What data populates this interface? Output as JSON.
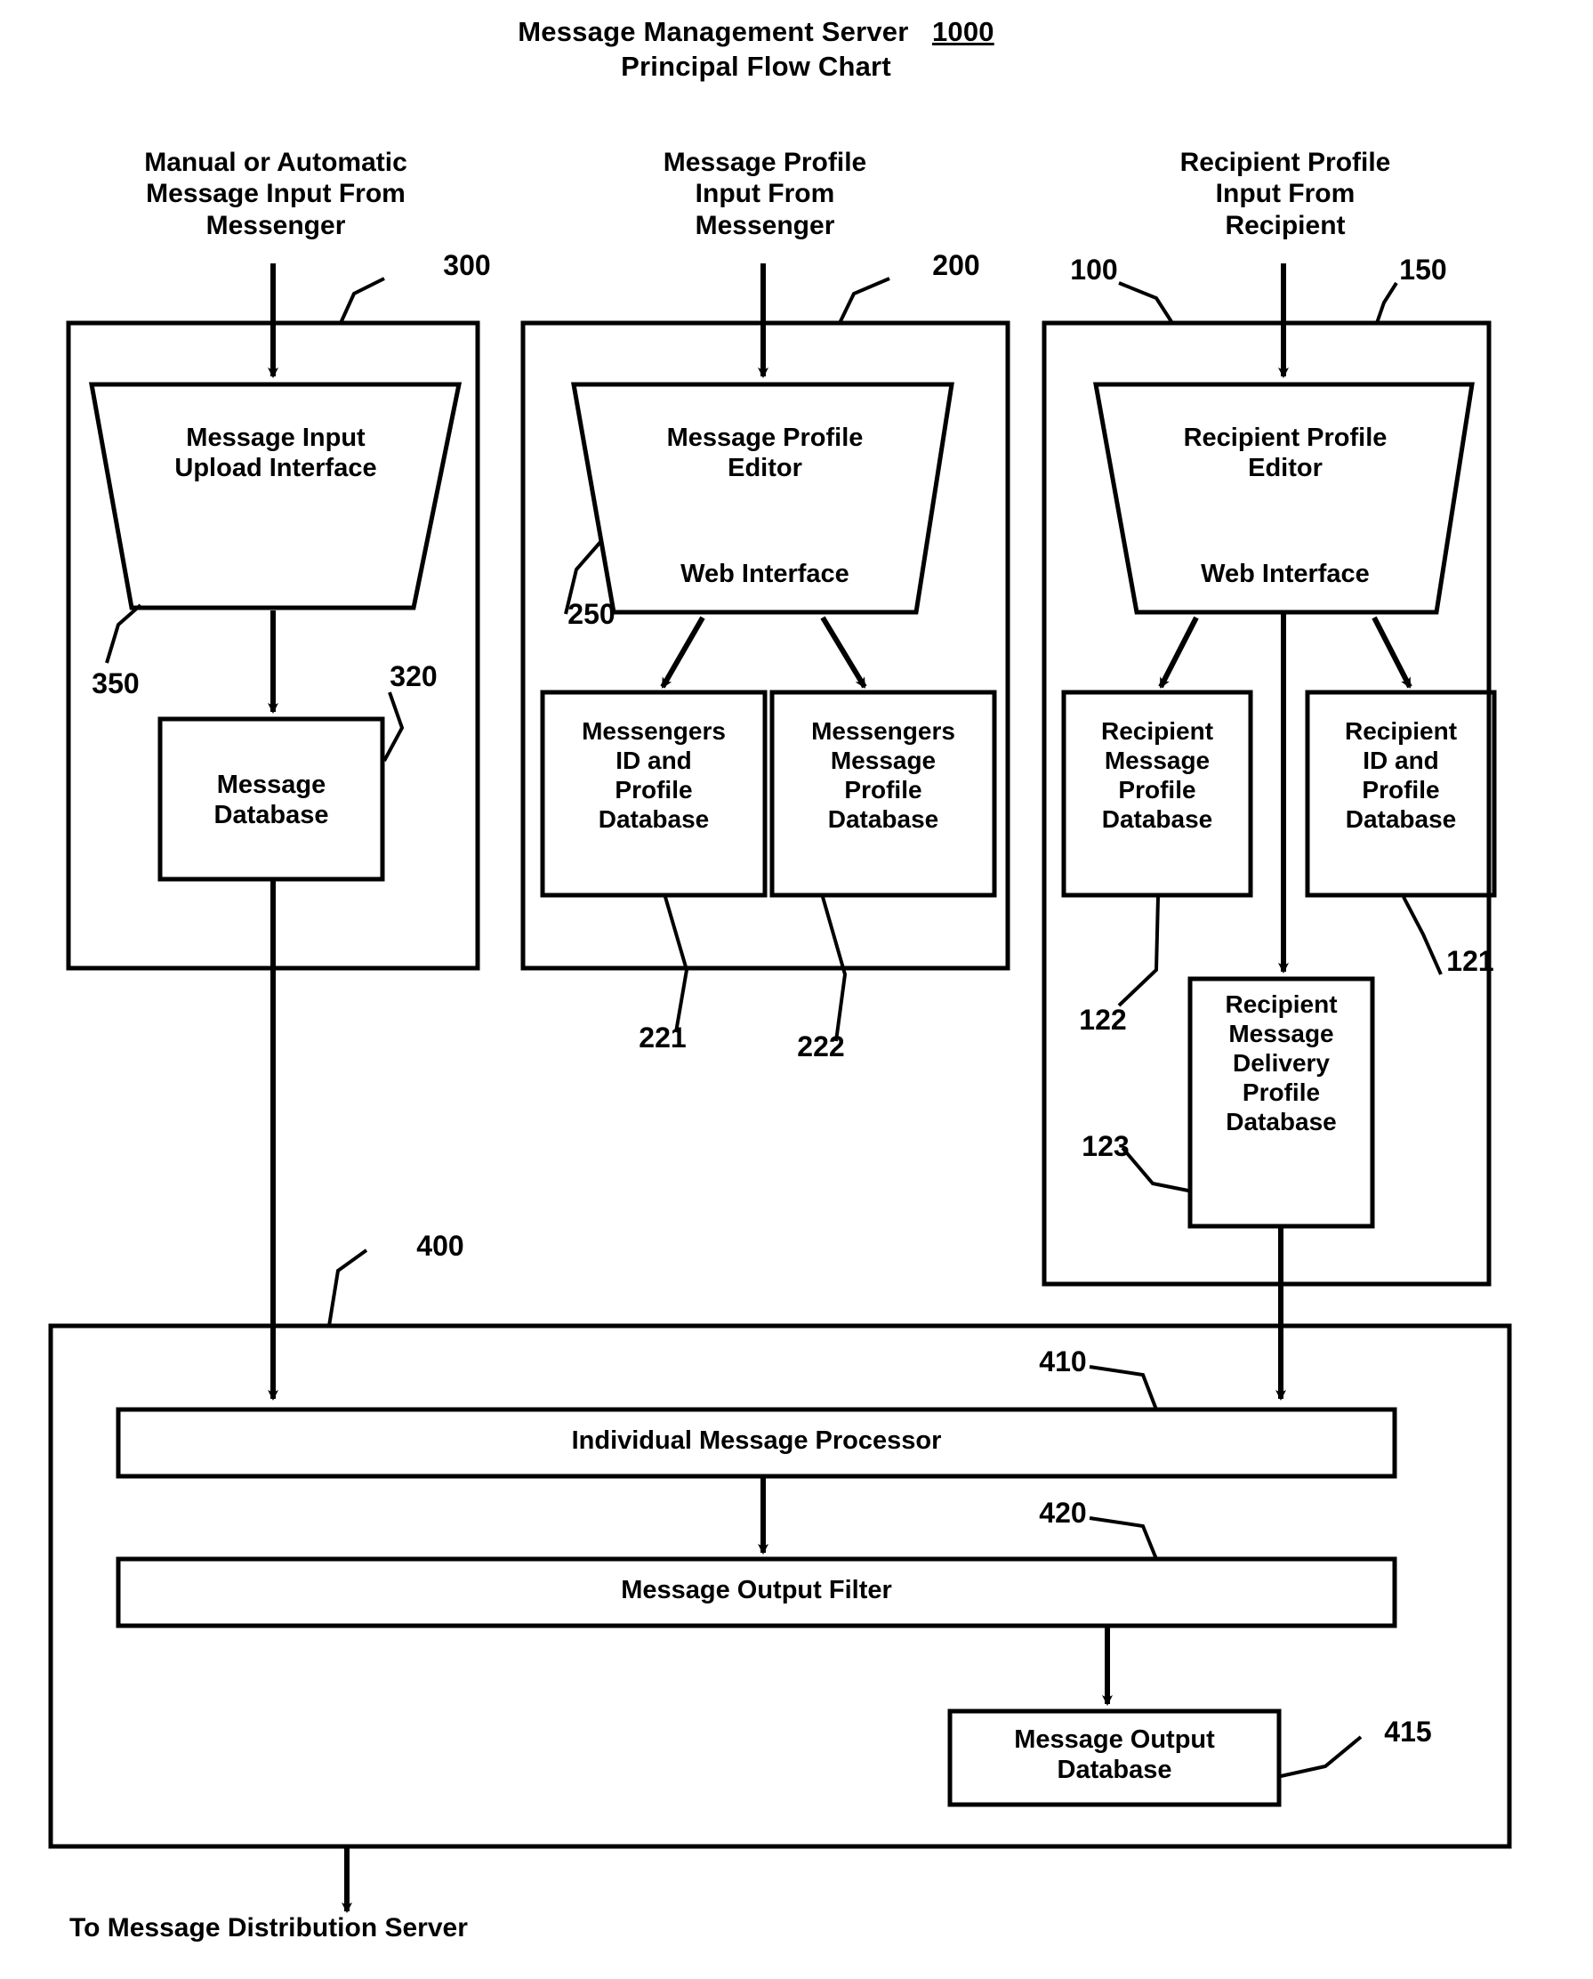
{
  "title": {
    "line1": "Message Management Server",
    "ref": "1000",
    "line2": "Principal Flow Chart"
  },
  "columns": [
    {
      "name": "message-input-column",
      "header": "Manual or Automatic\nMessage Input From\nMessenger",
      "container_ref": "300",
      "interface": {
        "label": "Message Input\nUpload Interface",
        "ref": "350"
      },
      "databases": [
        {
          "label": "Message\nDatabase",
          "ref": "320"
        }
      ]
    },
    {
      "name": "message-profile-column",
      "header": "Message Profile\nInput From\nMessenger",
      "container_ref": "200",
      "interface": {
        "label": "Message Profile\nEditor",
        "sub": "Web Interface",
        "ref": "250"
      },
      "databases": [
        {
          "label": "Messengers\nID and\nProfile\nDatabase",
          "ref": "221"
        },
        {
          "label": "Messengers\nMessage\nProfile\nDatabase",
          "ref": "222"
        }
      ]
    },
    {
      "name": "recipient-profile-column",
      "header": "Recipient Profile\nInput From\nRecipient",
      "container_ref": "100",
      "interface": {
        "label": "Recipient Profile\nEditor",
        "sub": "Web Interface",
        "ref": "150"
      },
      "databases": [
        {
          "label": "Recipient\nMessage\nProfile\nDatabase",
          "ref": "122"
        },
        {
          "label": "Recipient\nID and\nProfile\nDatabase",
          "ref": "121"
        },
        {
          "label": "Recipient\nMessage\nDelivery\nProfile\nDatabase",
          "ref": "123"
        }
      ]
    }
  ],
  "processor": {
    "container_ref": "400",
    "bars": [
      {
        "label": "Individual Message Processor",
        "ref": "410"
      },
      {
        "label": "Message Output Filter",
        "ref": "420"
      }
    ],
    "output_db": {
      "label": "Message Output\nDatabase",
      "ref": "415"
    }
  },
  "footer": "To Message Distribution Server"
}
